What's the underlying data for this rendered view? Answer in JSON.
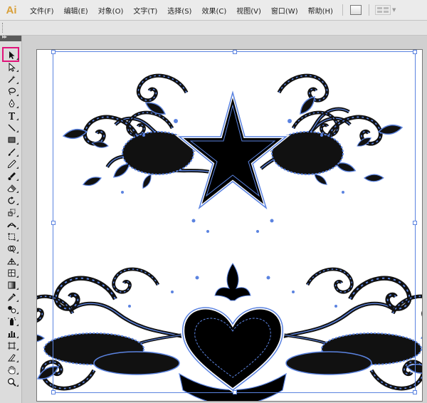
{
  "app": {
    "logo_text": "Ai",
    "logo_color": "#d9a03a"
  },
  "menu": [
    {
      "label": "文件(F)"
    },
    {
      "label": "编辑(E)"
    },
    {
      "label": "对象(O)"
    },
    {
      "label": "文字(T)"
    },
    {
      "label": "选择(S)"
    },
    {
      "label": "效果(C)"
    },
    {
      "label": "视图(V)"
    },
    {
      "label": "窗口(W)"
    },
    {
      "label": "帮助(H)"
    }
  ],
  "toolbar_icons": [
    "bridge-icon",
    "arrange-documents-icon"
  ],
  "tools": [
    "selection-tool-icon",
    "direct-selection-tool-icon",
    "magic-wand-tool-icon",
    "lasso-tool-icon",
    "pen-tool-icon",
    "type-tool-icon",
    "line-segment-tool-icon",
    "rectangle-tool-icon",
    "paintbrush-tool-icon",
    "pencil-tool-icon",
    "blob-brush-tool-icon",
    "eraser-tool-icon",
    "rotate-tool-icon",
    "scale-tool-icon",
    "width-tool-icon",
    "free-transform-tool-icon",
    "shape-builder-tool-icon",
    "perspective-grid-tool-icon",
    "mesh-tool-icon",
    "gradient-tool-icon",
    "eyedropper-tool-icon",
    "blend-tool-icon",
    "symbol-sprayer-tool-icon",
    "column-graph-tool-icon",
    "artboard-tool-icon",
    "slice-tool-icon",
    "hand-tool-icon",
    "zoom-tool-icon"
  ],
  "active_tool": "selection-tool-icon",
  "colors": {
    "highlight": "#e0137a",
    "selection": "#5b83e0",
    "artwork_fill": "#000000"
  }
}
